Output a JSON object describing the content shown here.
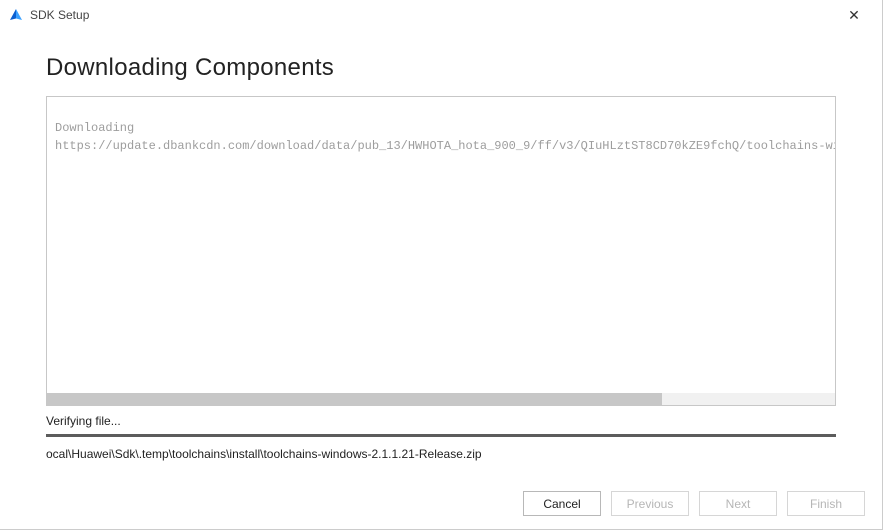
{
  "titlebar": {
    "title": "SDK Setup"
  },
  "heading": "Downloading Components",
  "log": {
    "line1": "Downloading",
    "line2": "https://update.dbankcdn.com/download/data/pub_13/HWHOTA_hota_900_9/ff/v3/QIuHLztST8CD70kZE9fchQ/toolchains-wi"
  },
  "status_text": "Verifying file...",
  "path_text": "ocal\\Huawei\\Sdk\\.temp\\toolchains\\install\\toolchains-windows-2.1.1.21-Release.zip",
  "buttons": {
    "cancel": "Cancel",
    "previous": "Previous",
    "next": "Next",
    "finish": "Finish"
  }
}
